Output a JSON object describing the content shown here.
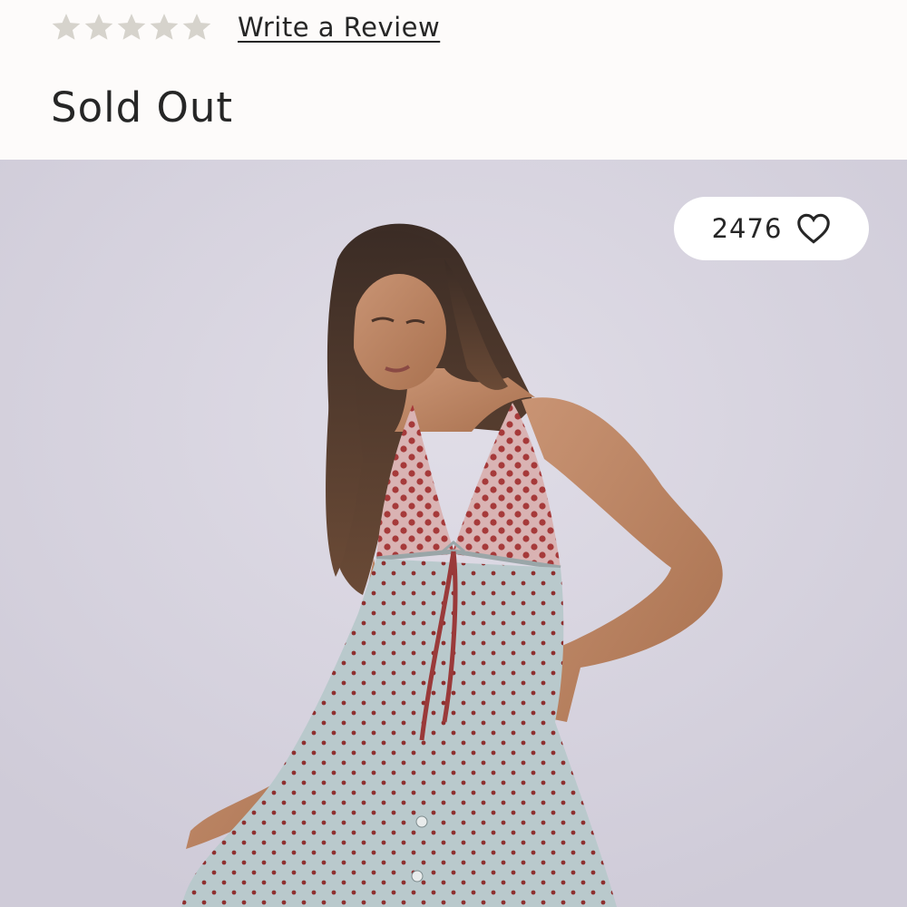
{
  "review": {
    "rating": 0,
    "max_rating": 5,
    "star_color": "#d6d3cc",
    "write_review_label": "Write a Review"
  },
  "product": {
    "availability": "Sold Out",
    "image_alt": "Model wearing a light blue polka dot halter maxi dress with red polka dot bodice"
  },
  "favorites": {
    "count": "2476",
    "icon": "heart-outline-icon"
  },
  "colors": {
    "page_background": "#fdfbfa",
    "image_background": "#d7d4df",
    "text": "#262626",
    "dress_base": "#b9c9cc",
    "dress_dot": "#8e2f2f",
    "bodice": "#c98d8d"
  }
}
